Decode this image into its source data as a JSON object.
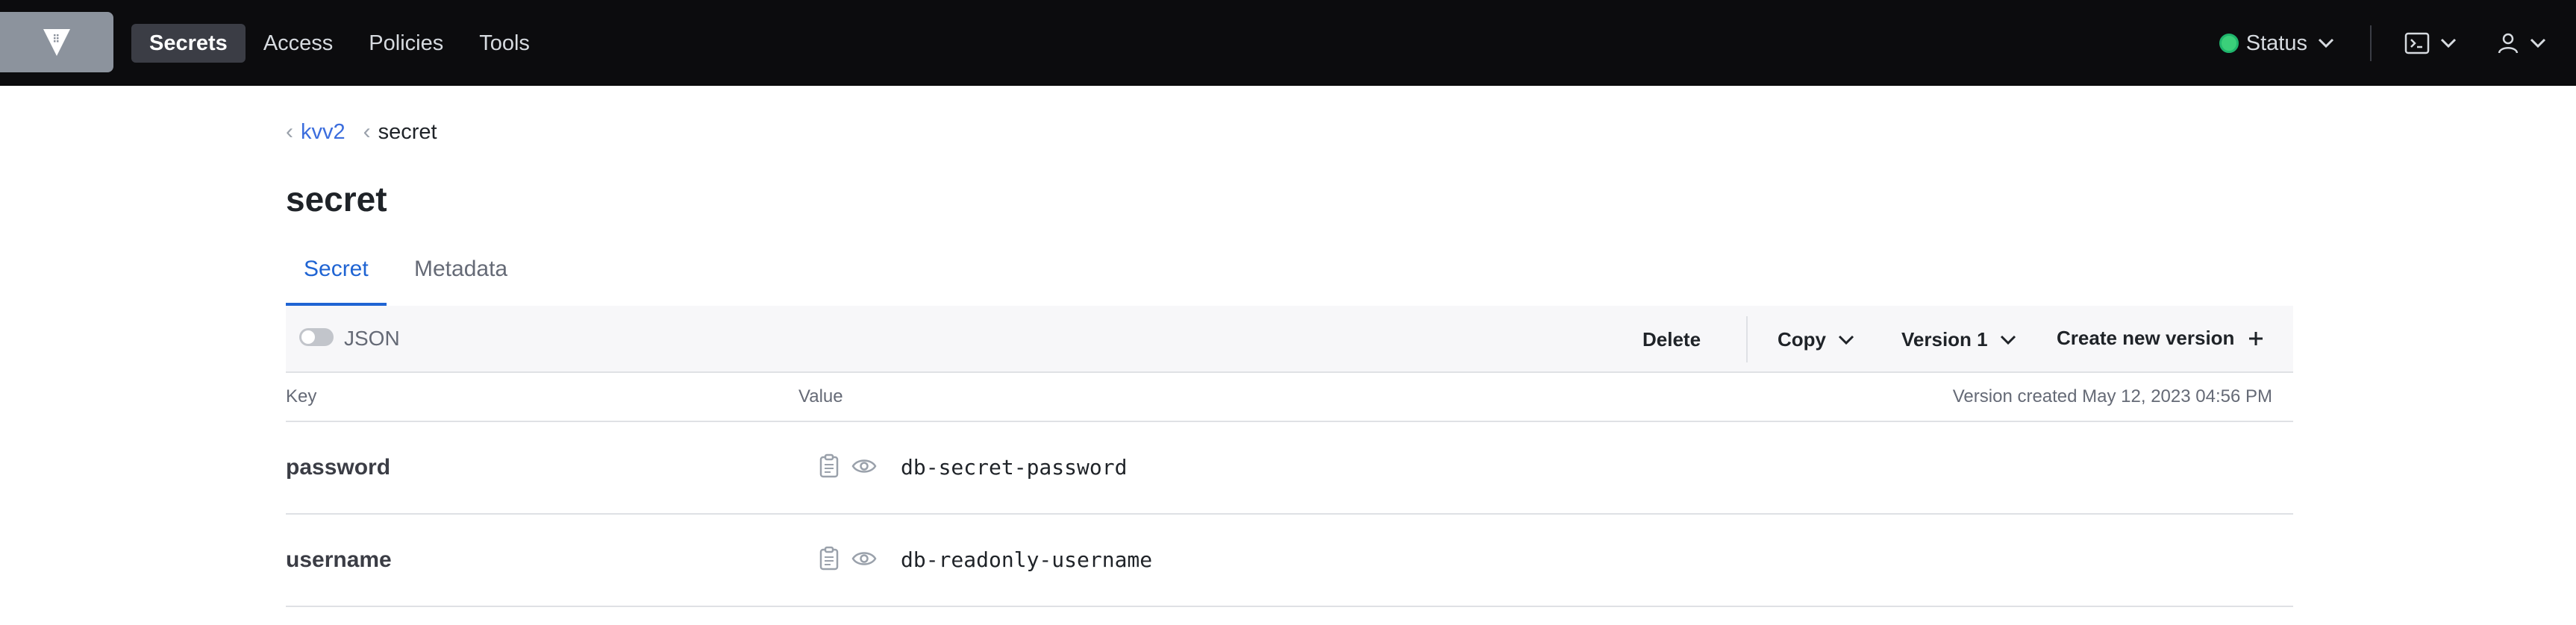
{
  "nav": {
    "logo_icon": "vault-logo-icon",
    "links": [
      {
        "label": "Secrets",
        "active": true
      },
      {
        "label": "Access",
        "active": false
      },
      {
        "label": "Policies",
        "active": false
      },
      {
        "label": "Tools",
        "active": false
      }
    ],
    "status_label": "Status",
    "status_color": "#3bd07a"
  },
  "breadcrumb": {
    "parent": "kvv2",
    "current": "secret"
  },
  "page": {
    "title": "secret",
    "tabs": [
      "Secret",
      "Metadata"
    ]
  },
  "toolbar": {
    "json_toggle_label": "JSON",
    "json_toggle_on": false,
    "delete_label": "Delete",
    "copy_label": "Copy",
    "version_label": "Version 1",
    "create_label": "Create new version"
  },
  "table": {
    "key_header": "Key",
    "value_header": "Value",
    "version_info": "Version created May 12, 2023 04:56 PM",
    "rows": [
      {
        "key": "password",
        "value": "db-secret-password"
      },
      {
        "key": "username",
        "value": "db-readonly-username"
      }
    ]
  },
  "colors": {
    "accent": "#1f64d3",
    "nav_bg": "#0c0c0e",
    "link": "#3b6ddd"
  }
}
